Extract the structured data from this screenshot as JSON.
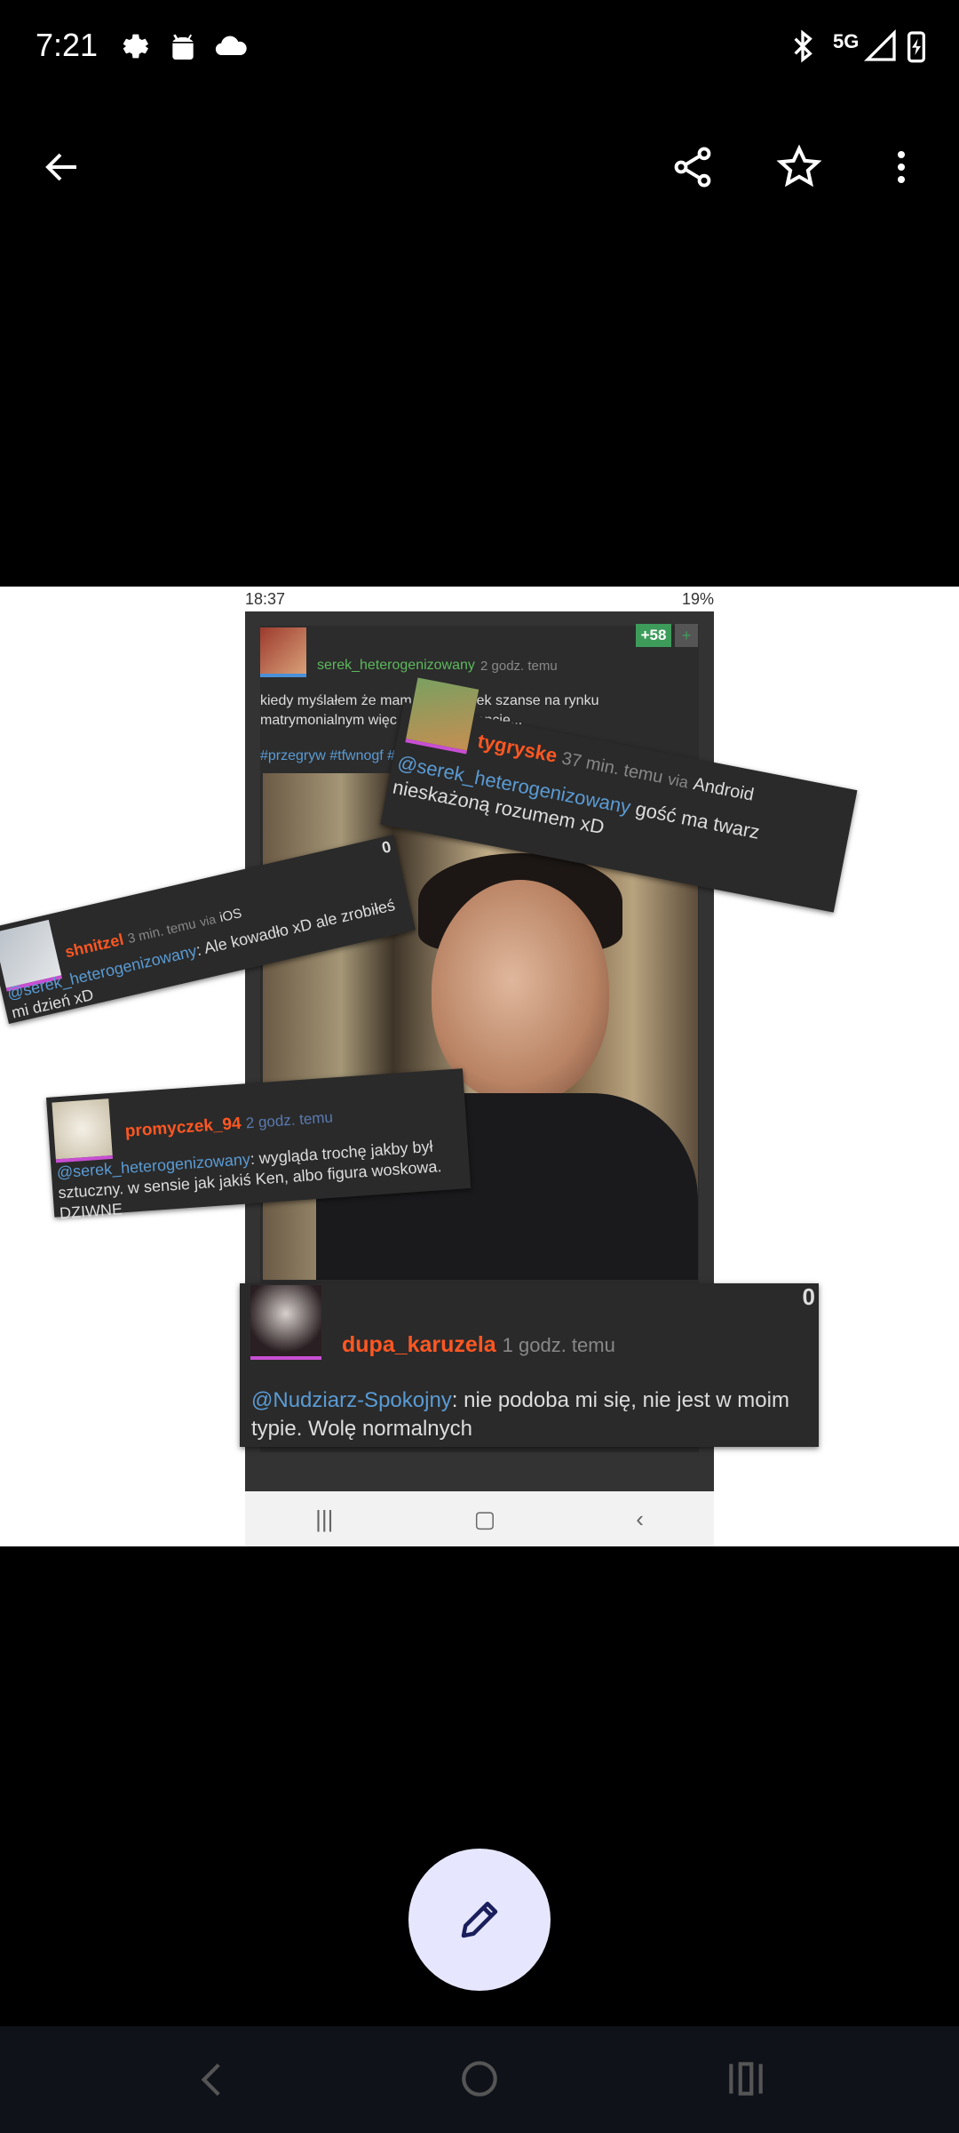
{
  "status_bar": {
    "time": "7:21",
    "network": "5G"
  },
  "colors": {
    "fab_bg": "#e6e7ff",
    "accent_user": "#ff5722",
    "mention": "#5a9bd4",
    "vote": "#3d9c5a"
  },
  "icons": [
    "back-arrow-icon",
    "share-icon",
    "star-icon",
    "more-icon",
    "edit-pencil-icon"
  ],
  "image": {
    "inner_status": {
      "time": "18:37",
      "battery": "19%"
    },
    "post": {
      "username": "serek_heterogenizowany",
      "time": "2 godz. temu",
      "votes": "+58",
      "plus": "+",
      "text": "kiedy myślałem że mam jakiekolwiek szanse na rynku matrymonialnym więc sp… konkurencję...",
      "tags": "#przegryw #tfwnogf #st"
    },
    "comments": [
      {
        "username": "tygryske",
        "time": "37 min. temu",
        "via_label": "via",
        "via": "Android",
        "mention": "@serek_heterogenizowany",
        "text": " gość ma twarz nieskażoną rozumem xD"
      },
      {
        "username": "shnitzel",
        "time": "3 min. temu",
        "via_label": "via",
        "via": "iOS",
        "mention": "@serek_heterogenizowany",
        "text": ": Ale kowadło xD ale zrobiłeś mi dzień xD",
        "score": "0"
      },
      {
        "username": "promyczek_94",
        "time": "2 godz. temu",
        "mention": "@serek_heterogenizowany",
        "text": ": wygląda trochę jakby był sztuczny. w sensie jak jakiś Ken, albo figura woskowa. DZIWNE"
      },
      {
        "username": "dupa_karuzela",
        "time": "1 godz. temu",
        "mention": "@Nudziarz-Spokojny",
        "text": ": nie podoba mi się, nie jest w moim typie. Wolę normalnych",
        "score": "0"
      }
    ]
  }
}
